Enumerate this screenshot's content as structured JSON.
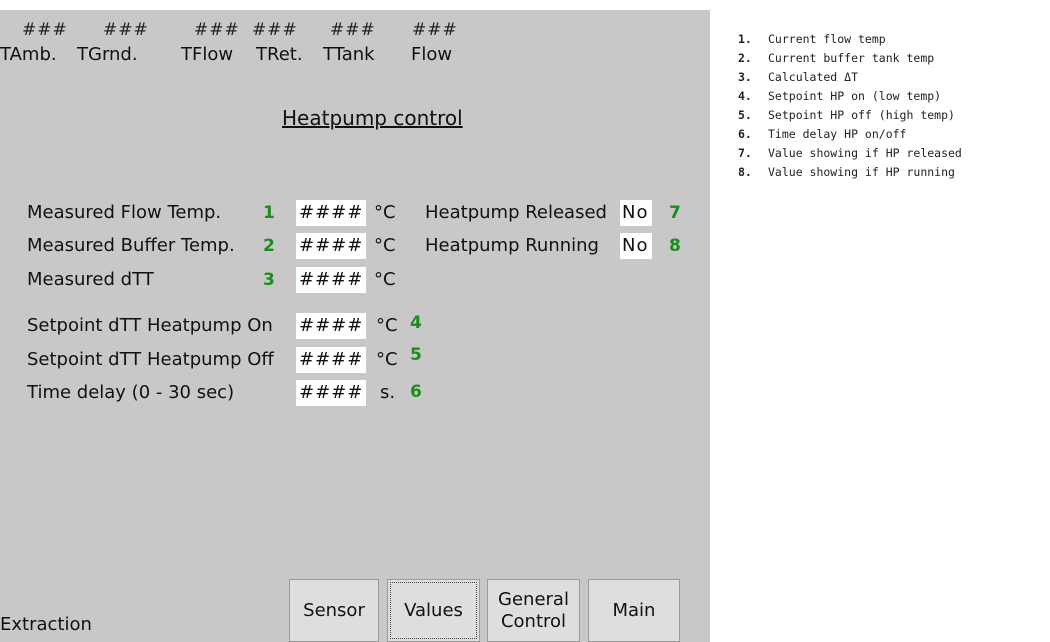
{
  "header": {
    "values": [
      "###",
      "###",
      "###",
      "###",
      "###",
      "###"
    ],
    "labels": [
      "TAmb.",
      "TGrnd.",
      "TFlow",
      "TRet.",
      "TTank",
      "Flow"
    ]
  },
  "title": "Heatpump control",
  "rows": {
    "flow": {
      "label": "Measured Flow Temp.",
      "num": "1",
      "value": "####",
      "unit": "°C"
    },
    "buffer": {
      "label": "Measured Buffer Temp.",
      "num": "2",
      "value": "####",
      "unit": "°C"
    },
    "dtt": {
      "label": "Measured dTT",
      "num": "3",
      "value": "####",
      "unit": "°C"
    },
    "on": {
      "label": "Setpoint dTT Heatpump On",
      "num": "4",
      "value": "####",
      "unit": "°C"
    },
    "off": {
      "label": "Setpoint dTT Heatpump Off",
      "num": "5",
      "value": "####",
      "unit": "°C"
    },
    "delay": {
      "label": "Time delay (0 - 30 sec)",
      "num": "6",
      "value": "####",
      "unit": "s."
    }
  },
  "status": {
    "released": {
      "label": "Heatpump Released",
      "value": "No",
      "num": "7"
    },
    "running": {
      "label": "Heatpump Running",
      "value": "No",
      "num": "8"
    }
  },
  "footer": {
    "left_label": "Extraction",
    "buttons": [
      "Sensor",
      "Values",
      "General Control",
      "Main"
    ],
    "active_button": "Values"
  },
  "notes": [
    {
      "n": "1.",
      "text": "Current flow temp"
    },
    {
      "n": "2.",
      "text": "Current buffer tank temp"
    },
    {
      "n": "3.",
      "text": "Calculated ΔT"
    },
    {
      "n": "4.",
      "text": "Setpoint HP on (low temp)"
    },
    {
      "n": "5.",
      "text": "Setpoint HP off (high temp)"
    },
    {
      "n": "6.",
      "text": "Time delay HP on/off"
    },
    {
      "n": "7.",
      "text": "Value showing if HP released"
    },
    {
      "n": "8.",
      "text": "Value showing if HP running"
    }
  ],
  "colors": {
    "panel": "#c8c8c8",
    "accent_numbers": "#1c8c1c",
    "field": "#ffffff"
  }
}
